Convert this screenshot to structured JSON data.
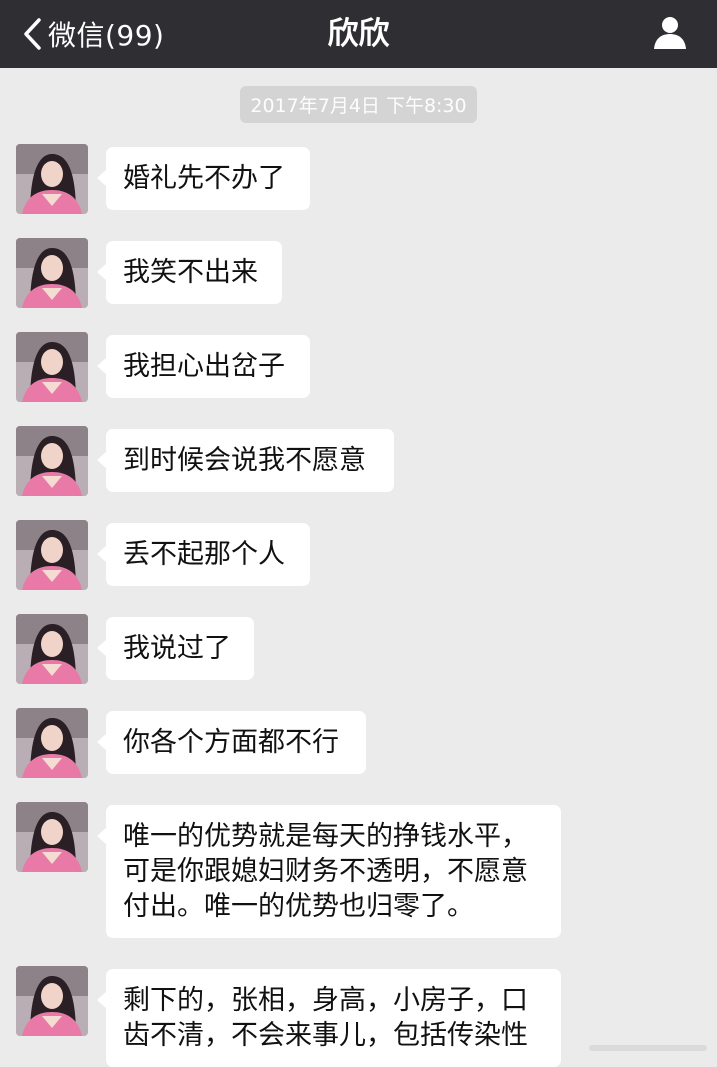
{
  "header": {
    "back_label": "微信(99)",
    "title": "欣欣",
    "back_icon": "chevron-left-icon",
    "profile_icon": "person-icon"
  },
  "timestamp": "2017年7月4日 下午8:30",
  "colors": {
    "topbar": "#2e2e33",
    "background": "#ebebeb",
    "bubble": "#ffffff",
    "timestamp_bg": "#d4d4d4"
  },
  "messages": [
    {
      "sender": "欣欣",
      "text": "婚礼先不办了"
    },
    {
      "sender": "欣欣",
      "text": "我笑不出来"
    },
    {
      "sender": "欣欣",
      "text": "我担心出岔子"
    },
    {
      "sender": "欣欣",
      "text": "到时候会说我不愿意"
    },
    {
      "sender": "欣欣",
      "text": "丢不起那个人"
    },
    {
      "sender": "欣欣",
      "text": "我说过了"
    },
    {
      "sender": "欣欣",
      "text": "你各个方面都不行"
    },
    {
      "sender": "欣欣",
      "text": "唯一的优势就是每天的挣钱水平，\n可是你跟媳妇财务不透明，不愿意\n付出。唯一的优势也归零了。"
    },
    {
      "sender": "欣欣",
      "text": "剩下的，张相，身高，小房子，口\n齿不清，不会来事儿，包括传染性"
    }
  ]
}
